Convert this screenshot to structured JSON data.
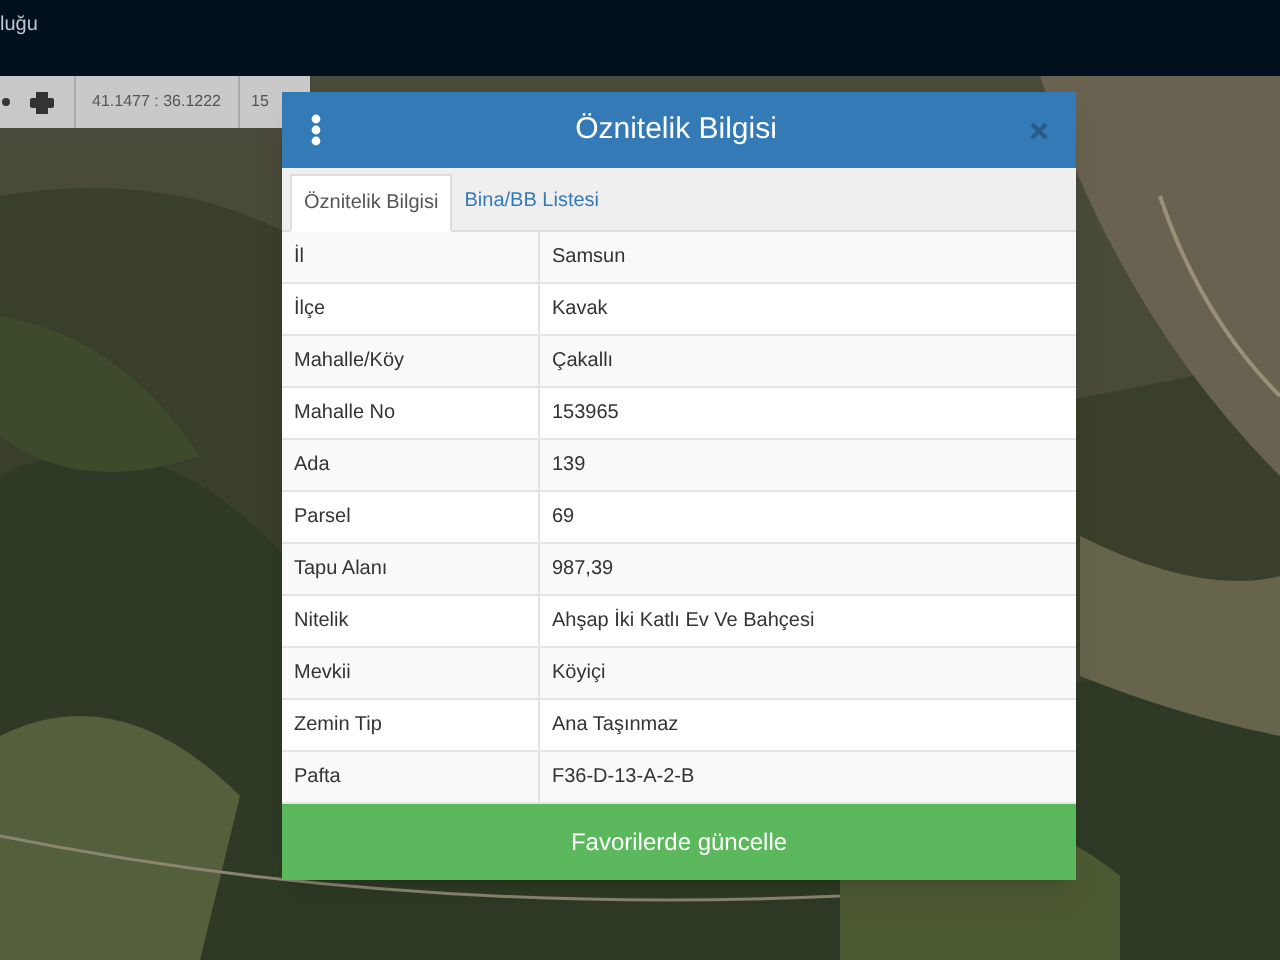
{
  "header": {
    "title": "luğu"
  },
  "toolbar": {
    "coordinates": "41.1477 : 36.1222",
    "scale": "15"
  },
  "dialog": {
    "title": "Öznitelik Bilgisi",
    "tabs": [
      {
        "label": "Öznitelik Bilgisi",
        "selected": true
      },
      {
        "label": "Bina/BB Listesi",
        "selected": false
      }
    ],
    "rows": [
      {
        "label": "İl",
        "value": "Samsun"
      },
      {
        "label": "İlçe",
        "value": "Kavak"
      },
      {
        "label": "Mahalle/Köy",
        "value": "Çakallı"
      },
      {
        "label": "Mahalle No",
        "value": "153965"
      },
      {
        "label": "Ada",
        "value": "139"
      },
      {
        "label": "Parsel",
        "value": "69"
      },
      {
        "label": "Tapu Alanı",
        "value": "987,39"
      },
      {
        "label": "Nitelik",
        "value": "Ahşap İki Katlı Ev Ve Bahçesi"
      },
      {
        "label": "Mevkii",
        "value": "Köyiçi"
      },
      {
        "label": "Zemin Tip",
        "value": "Ana Taşınmaz"
      },
      {
        "label": "Pafta",
        "value": "F36-D-13-A-2-B"
      }
    ],
    "button": "Favorilerde güncelle"
  }
}
